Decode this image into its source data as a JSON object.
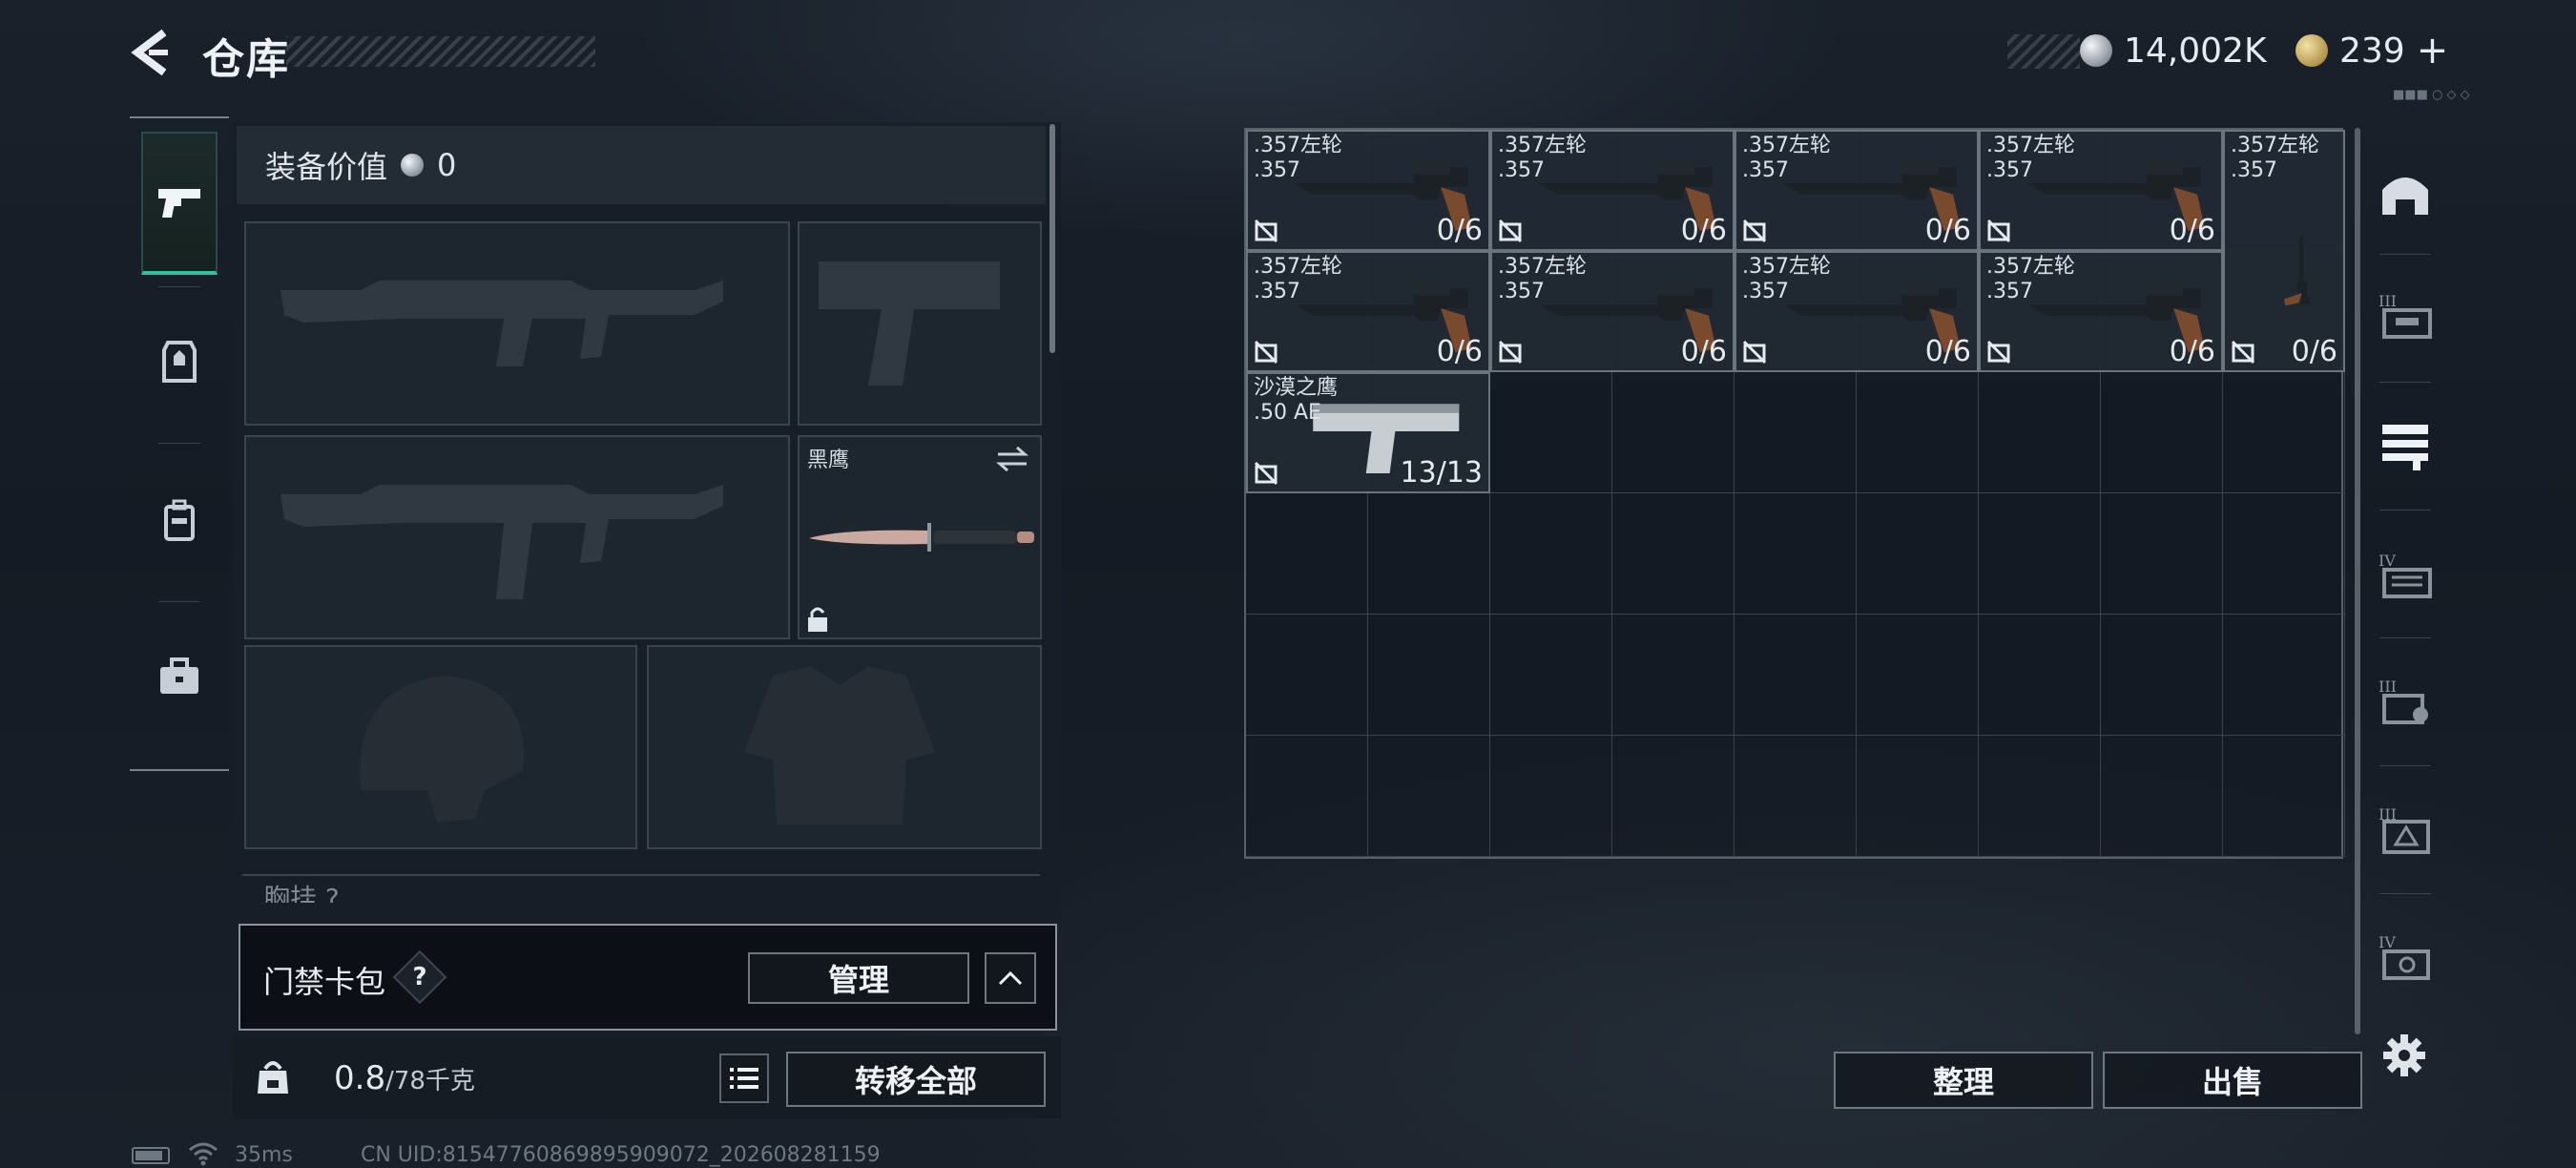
{
  "header": {
    "title": "仓库",
    "silver": "14,002K",
    "gold": "239",
    "plus": "+",
    "tiny": "■■■ ○ ◇ ◇"
  },
  "equipment": {
    "value_label": "装备价值",
    "value": "0",
    "melee_name": "黑鹰",
    "partial_label": "胸挂 ?"
  },
  "keycard": {
    "label": "门禁卡包",
    "help": "?",
    "manage_label": "管理"
  },
  "capacity": {
    "current": "0.8",
    "max": "/78千克",
    "transfer_label": "转移全部"
  },
  "items": [
    {
      "name": ".357左轮",
      "caliber": ".357",
      "count": "0/6"
    },
    {
      "name": ".357左轮",
      "caliber": ".357",
      "count": "0/6"
    },
    {
      "name": ".357左轮",
      "caliber": ".357",
      "count": "0/6"
    },
    {
      "name": ".357左轮",
      "caliber": ".357",
      "count": "0/6"
    },
    {
      "name": ".357左轮",
      "caliber": ".357",
      "count": "0/6"
    },
    {
      "name": ".357左轮",
      "caliber": ".357",
      "count": "0/6"
    },
    {
      "name": ".357左轮",
      "caliber": ".357",
      "count": "0/6"
    },
    {
      "name": ".357左轮",
      "caliber": ".357",
      "count": "0/6"
    },
    {
      "name": ".357左轮",
      "caliber": ".357",
      "count": "0/6"
    },
    {
      "name": "沙漠之鹰",
      "caliber": ".50 AE",
      "count": "13/13"
    }
  ],
  "actions": {
    "sort_label": "整理",
    "sell_label": "出售"
  },
  "footer": {
    "ping": "35ms",
    "uid": "CN UID:815477608698959090​72_202608281159"
  },
  "category_tiers": [
    "III",
    "IV",
    "III",
    "III",
    "IV"
  ],
  "colors": {
    "accent": "#2fc39c",
    "panel": "#181f28"
  }
}
